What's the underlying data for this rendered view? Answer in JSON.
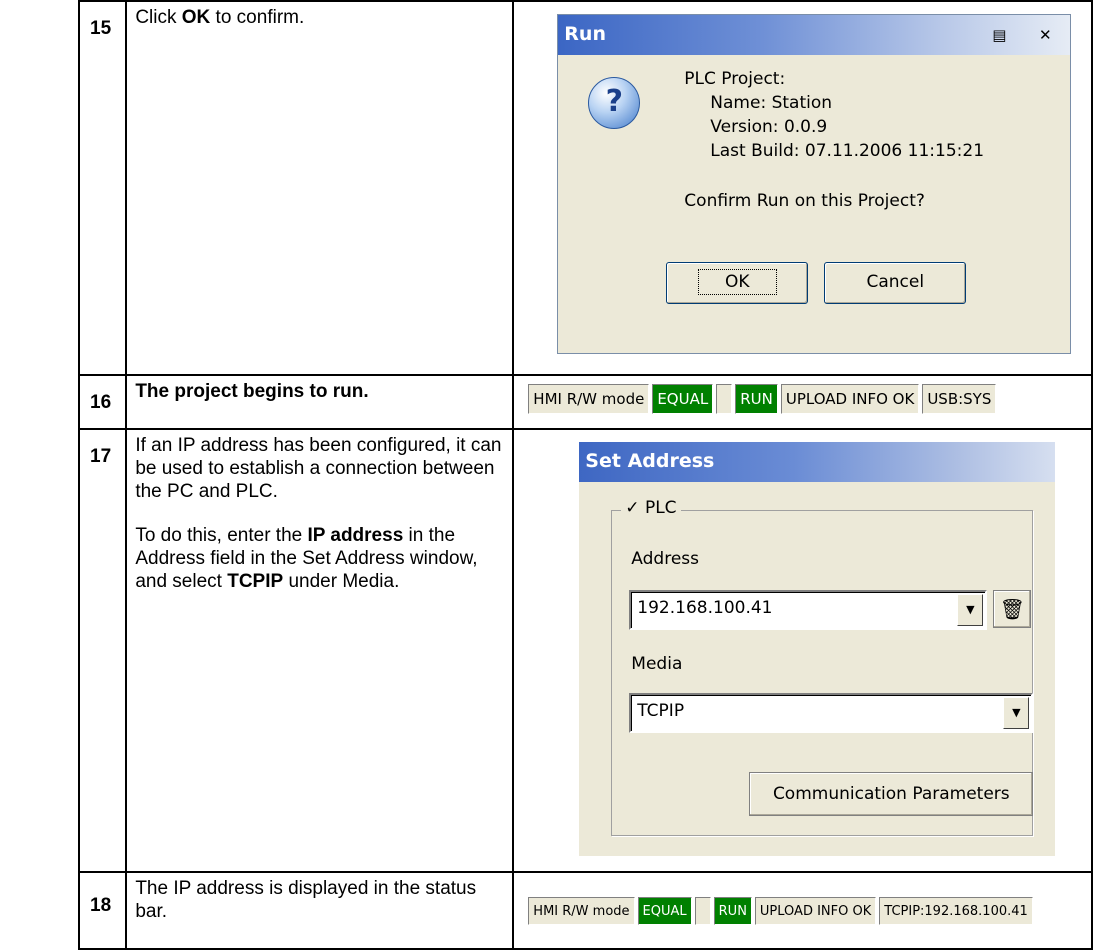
{
  "steps": [
    {
      "num": "15",
      "text": [
        "Click ",
        "OK",
        " to confirm."
      ]
    },
    {
      "num": "16",
      "text": "The project begins to run."
    },
    {
      "num": "17",
      "p1": "If an IP address has been configured, it can be used to establish a connection between the PC and PLC.",
      "p2": [
        "To do this, enter the ",
        "IP address",
        " in the Address field in the Set Address window, and select ",
        "TCPIP",
        " under Media."
      ]
    },
    {
      "num": "18",
      "text": "The IP address is displayed in the status bar."
    }
  ],
  "run_dialog": {
    "title": "Run",
    "icon": "question-icon",
    "project_label": "PLC Project:",
    "name_line": "Name:  Station",
    "version_line": "Version:  0.0.9",
    "build_line": "Last Build:  07.11.2006 11:15:21",
    "confirm": "Confirm Run on this Project?",
    "ok_label": "OK",
    "cancel_label": "Cancel"
  },
  "status_bar_1": [
    "HMI R/W mode",
    "EQUAL",
    "",
    "RUN",
    "UPLOAD INFO OK",
    "USB:SYS"
  ],
  "status_bar_2": [
    "HMI R/W mode",
    "EQUAL",
    "",
    "RUN",
    "UPLOAD INFO OK",
    "TCPIP:192.168.100.41"
  ],
  "set_address": {
    "title": "Set Address",
    "group_label": "✓ PLC",
    "address_label": "Address",
    "address_value": "192.168.100.41",
    "media_label": "Media",
    "media_value": "TCPIP",
    "comm_button": "Communication Parameters"
  },
  "colors": {
    "status_green": "#008000",
    "title_blue": "#3b66c4",
    "dialog_bg": "#ece9d8"
  }
}
